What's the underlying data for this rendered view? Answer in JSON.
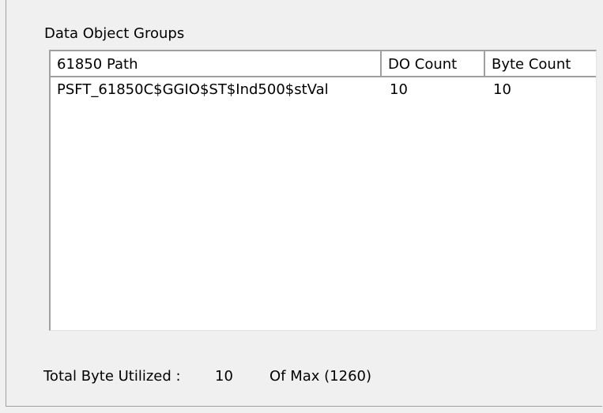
{
  "group_box": {
    "title": "Data Object Groups"
  },
  "list": {
    "columns": [
      "61850 Path",
      "DO Count",
      "Byte Count"
    ],
    "rows": [
      {
        "path": "PSFT_61850C$GGIO$ST$Ind500$stVal",
        "do_count": "10",
        "byte_count": "10"
      }
    ]
  },
  "footer": {
    "label": "Total Byte Utilized :",
    "value": "10",
    "max_text": "Of Max (1260)"
  }
}
